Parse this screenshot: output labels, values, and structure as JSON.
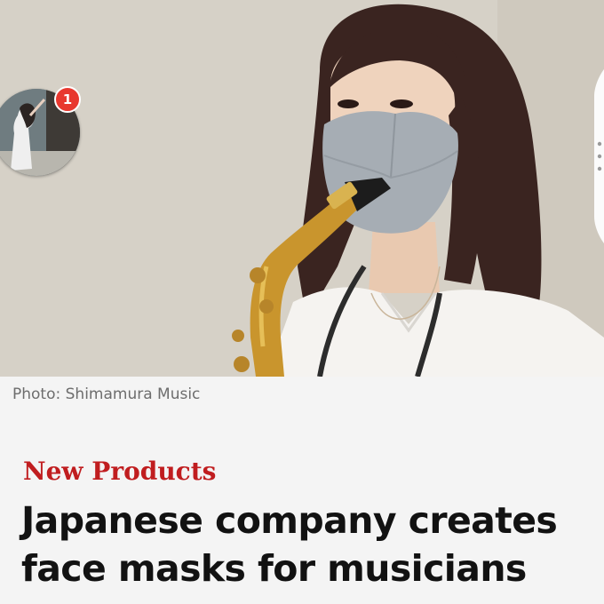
{
  "photo": {
    "caption": "Photo: Shimamura Music"
  },
  "chat_head": {
    "badge_count": "1"
  },
  "article": {
    "category": "New Products",
    "headline": "Japanese company creates face masks for musicians"
  },
  "colors": {
    "category_red": "#c01d1f",
    "badge_red": "#e8382f",
    "headline": "#121212",
    "caption_gray": "#6d6d6d"
  }
}
